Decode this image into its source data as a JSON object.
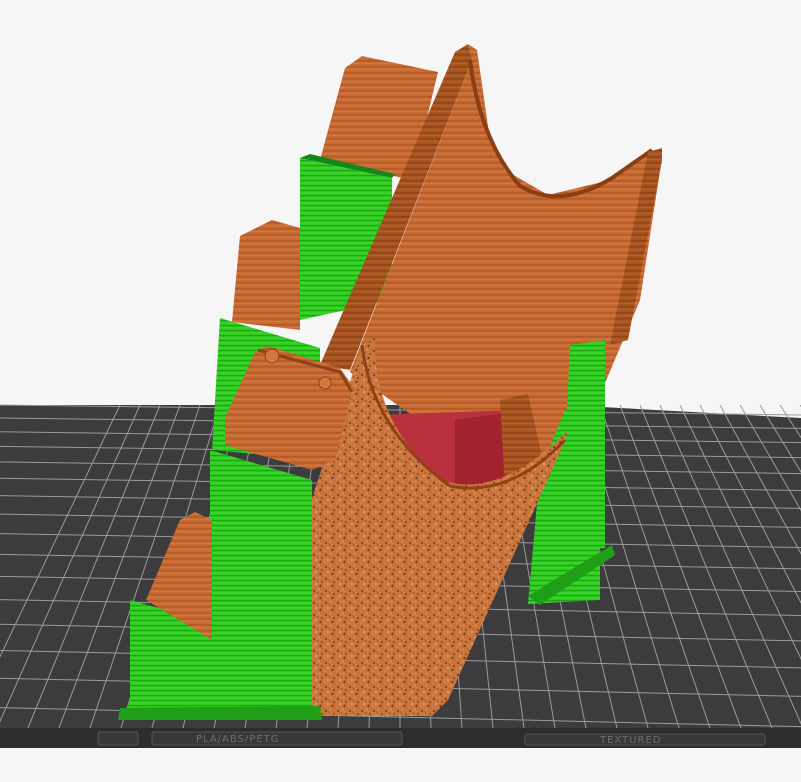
{
  "viewport": {
    "background_color": "#f6f6f6",
    "bed_color": "#3c3c3e",
    "grid_color": "#9a9a9a",
    "model_color": "#c86a32",
    "model_dark_color": "#8e4216",
    "support_color": "#2ecc1e",
    "support_dark_color": "#138a0e",
    "overhang_color": "#b8303c"
  },
  "build_plate": {
    "label_left": "PLA/ABS/PETG",
    "label_right": "TEXTURED"
  }
}
